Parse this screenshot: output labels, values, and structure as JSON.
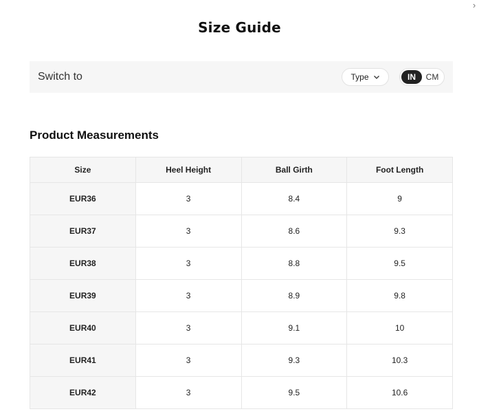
{
  "close_icon_glyph": "›",
  "title": "Size Guide",
  "switch": {
    "label": "Switch to",
    "type_select": {
      "label": "Type",
      "icon": "chevron-down-icon"
    },
    "units": [
      {
        "label": "IN",
        "active": true
      },
      {
        "label": "CM",
        "active": false
      }
    ]
  },
  "product_measurements": {
    "title": "Product Measurements",
    "columns": [
      "Size",
      "Heel Height",
      "Ball Girth",
      "Foot Length"
    ],
    "rows": [
      [
        "EUR36",
        "3",
        "8.4",
        "9"
      ],
      [
        "EUR37",
        "3",
        "8.6",
        "9.3"
      ],
      [
        "EUR38",
        "3",
        "8.8",
        "9.5"
      ],
      [
        "EUR39",
        "3",
        "8.9",
        "9.8"
      ],
      [
        "EUR40",
        "3",
        "9.1",
        "10"
      ],
      [
        "EUR41",
        "3",
        "9.3",
        "10.3"
      ],
      [
        "EUR42",
        "3",
        "9.5",
        "10.6"
      ]
    ]
  },
  "colors": {
    "accent": "#222222",
    "panel_bg": "#f6f6f6",
    "border": "#e6e6e6"
  }
}
